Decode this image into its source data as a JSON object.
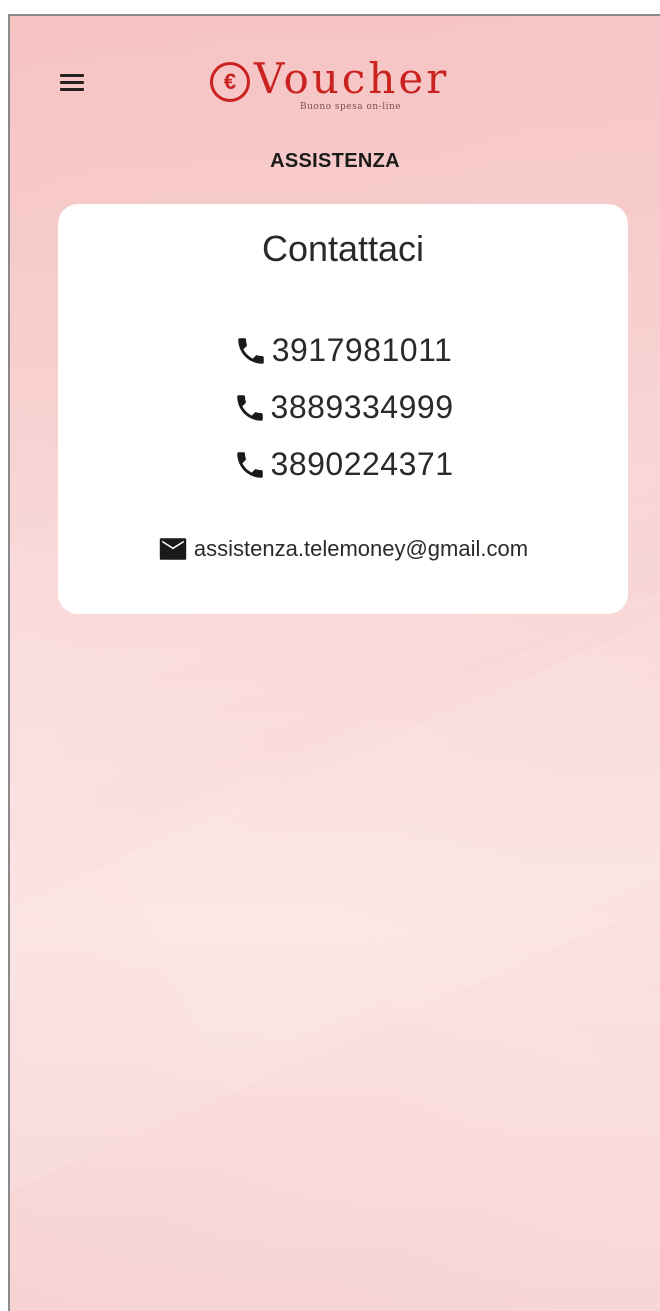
{
  "header": {
    "menu_icon": "hamburger-menu-icon",
    "logo_symbol": "€",
    "logo_text": "Voucher",
    "logo_tagline": "Buono spesa on-line",
    "title": "ASSISTENZA"
  },
  "contact_card": {
    "title": "Contattaci",
    "phones": [
      {
        "icon": "phone-icon",
        "number": "3917981011"
      },
      {
        "icon": "phone-icon",
        "number": "3889334999"
      },
      {
        "icon": "phone-icon",
        "number": "3890224371"
      }
    ],
    "email": {
      "icon": "mail-icon",
      "address": "assistenza.telemoney@gmail.com"
    }
  },
  "colors": {
    "brand_red": "#c9221f",
    "background_pink": "#f9d0d0",
    "card_white": "#ffffff",
    "text_dark": "#2a2a2a"
  }
}
